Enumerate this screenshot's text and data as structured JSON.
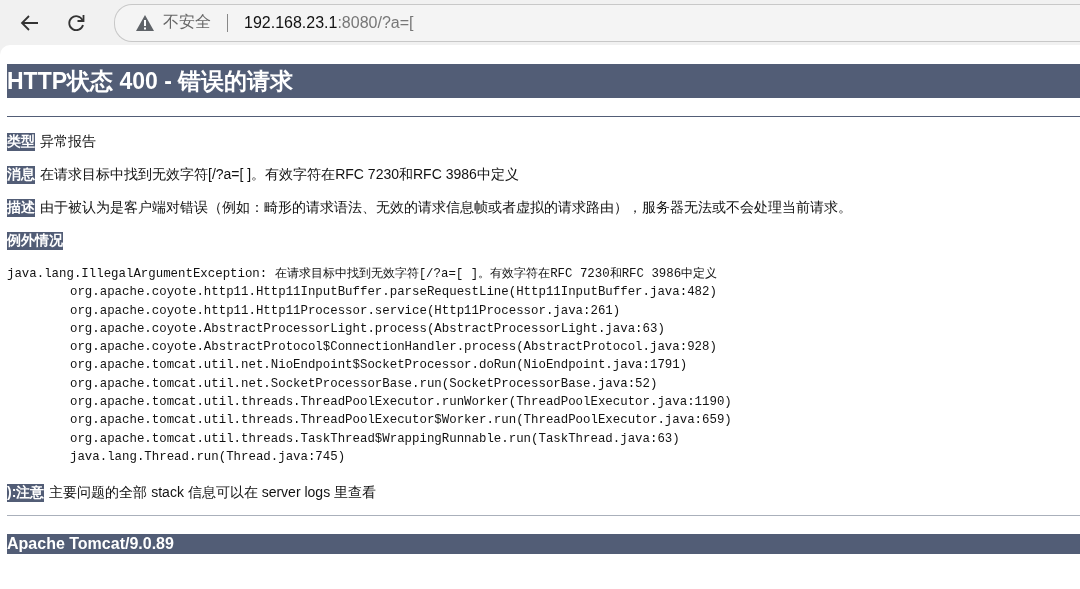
{
  "browser": {
    "security_label": "不安全",
    "url_host": "192.168.23.1",
    "url_rest": ":8080/?a=["
  },
  "page": {
    "title": "HTTP状态 400 - 错误的请求",
    "fields": [
      {
        "label": "类型",
        "value": "异常报告"
      },
      {
        "label": "消息",
        "value": "在请求目标中找到无效字符[/?a=[ ]。有效字符在RFC 7230和RFC 3986中定义"
      },
      {
        "label": "描述",
        "value": "由于被认为是客户端对错误（例如：畸形的请求语法、无效的请求信息帧或者虚拟的请求路由），服务器无法或不会处理当前请求。"
      }
    ],
    "exception_label": "例外情况",
    "stack_trace": [
      {
        "kind": "exception",
        "text": "java.lang.IllegalArgumentException: 在请求目标中找到无效字符[/?a=[ ]。有效字符在RFC 7230和RFC 3986中定义"
      },
      {
        "kind": "frame",
        "text": "org.apache.coyote.http11.Http11InputBuffer.parseRequestLine(Http11InputBuffer.java:482)"
      },
      {
        "kind": "frame",
        "text": "org.apache.coyote.http11.Http11Processor.service(Http11Processor.java:261)"
      },
      {
        "kind": "frame",
        "text": "org.apache.coyote.AbstractProcessorLight.process(AbstractProcessorLight.java:63)"
      },
      {
        "kind": "frame",
        "text": "org.apache.coyote.AbstractProtocol$ConnectionHandler.process(AbstractProtocol.java:928)"
      },
      {
        "kind": "frame",
        "text": "org.apache.tomcat.util.net.NioEndpoint$SocketProcessor.doRun(NioEndpoint.java:1791)"
      },
      {
        "kind": "frame",
        "text": "org.apache.tomcat.util.net.SocketProcessorBase.run(SocketProcessorBase.java:52)"
      },
      {
        "kind": "frame",
        "text": "org.apache.tomcat.util.threads.ThreadPoolExecutor.runWorker(ThreadPoolExecutor.java:1190)"
      },
      {
        "kind": "frame",
        "text": "org.apache.tomcat.util.threads.ThreadPoolExecutor$Worker.run(ThreadPoolExecutor.java:659)"
      },
      {
        "kind": "frame",
        "text": "org.apache.tomcat.util.threads.TaskThread$WrappingRunnable.run(TaskThread.java:63)"
      },
      {
        "kind": "frame",
        "text": "java.lang.Thread.run(Thread.java:745)"
      }
    ],
    "note": {
      "label": "):注意",
      "value": "主要问题的全部 stack 信息可以在 server logs 里查看"
    },
    "footer": "Apache Tomcat/9.0.89"
  }
}
